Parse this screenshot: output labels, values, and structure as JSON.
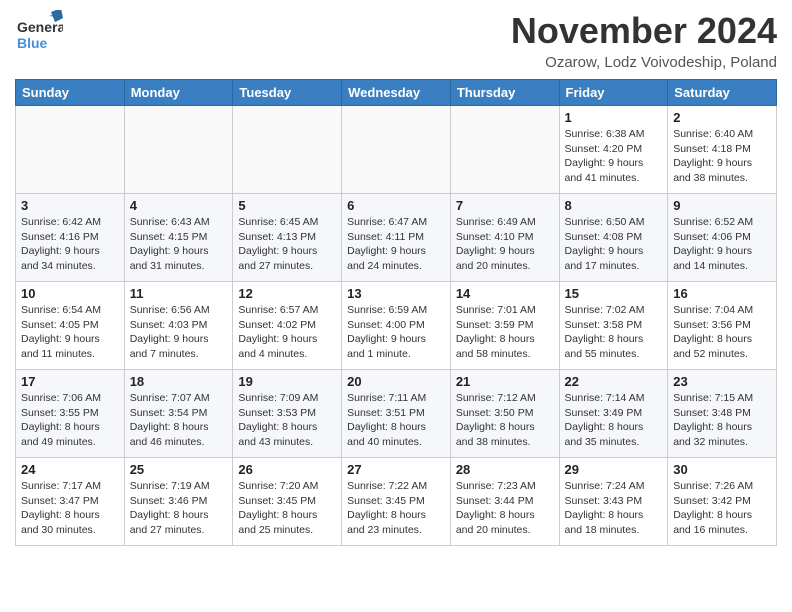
{
  "header": {
    "logo_line1": "General",
    "logo_line2": "Blue",
    "month_title": "November 2024",
    "location": "Ozarow, Lodz Voivodeship, Poland"
  },
  "weekdays": [
    "Sunday",
    "Monday",
    "Tuesday",
    "Wednesday",
    "Thursday",
    "Friday",
    "Saturday"
  ],
  "weeks": [
    [
      {
        "day": "",
        "info": ""
      },
      {
        "day": "",
        "info": ""
      },
      {
        "day": "",
        "info": ""
      },
      {
        "day": "",
        "info": ""
      },
      {
        "day": "",
        "info": ""
      },
      {
        "day": "1",
        "info": "Sunrise: 6:38 AM\nSunset: 4:20 PM\nDaylight: 9 hours\nand 41 minutes."
      },
      {
        "day": "2",
        "info": "Sunrise: 6:40 AM\nSunset: 4:18 PM\nDaylight: 9 hours\nand 38 minutes."
      }
    ],
    [
      {
        "day": "3",
        "info": "Sunrise: 6:42 AM\nSunset: 4:16 PM\nDaylight: 9 hours\nand 34 minutes."
      },
      {
        "day": "4",
        "info": "Sunrise: 6:43 AM\nSunset: 4:15 PM\nDaylight: 9 hours\nand 31 minutes."
      },
      {
        "day": "5",
        "info": "Sunrise: 6:45 AM\nSunset: 4:13 PM\nDaylight: 9 hours\nand 27 minutes."
      },
      {
        "day": "6",
        "info": "Sunrise: 6:47 AM\nSunset: 4:11 PM\nDaylight: 9 hours\nand 24 minutes."
      },
      {
        "day": "7",
        "info": "Sunrise: 6:49 AM\nSunset: 4:10 PM\nDaylight: 9 hours\nand 20 minutes."
      },
      {
        "day": "8",
        "info": "Sunrise: 6:50 AM\nSunset: 4:08 PM\nDaylight: 9 hours\nand 17 minutes."
      },
      {
        "day": "9",
        "info": "Sunrise: 6:52 AM\nSunset: 4:06 PM\nDaylight: 9 hours\nand 14 minutes."
      }
    ],
    [
      {
        "day": "10",
        "info": "Sunrise: 6:54 AM\nSunset: 4:05 PM\nDaylight: 9 hours\nand 11 minutes."
      },
      {
        "day": "11",
        "info": "Sunrise: 6:56 AM\nSunset: 4:03 PM\nDaylight: 9 hours\nand 7 minutes."
      },
      {
        "day": "12",
        "info": "Sunrise: 6:57 AM\nSunset: 4:02 PM\nDaylight: 9 hours\nand 4 minutes."
      },
      {
        "day": "13",
        "info": "Sunrise: 6:59 AM\nSunset: 4:00 PM\nDaylight: 9 hours\nand 1 minute."
      },
      {
        "day": "14",
        "info": "Sunrise: 7:01 AM\nSunset: 3:59 PM\nDaylight: 8 hours\nand 58 minutes."
      },
      {
        "day": "15",
        "info": "Sunrise: 7:02 AM\nSunset: 3:58 PM\nDaylight: 8 hours\nand 55 minutes."
      },
      {
        "day": "16",
        "info": "Sunrise: 7:04 AM\nSunset: 3:56 PM\nDaylight: 8 hours\nand 52 minutes."
      }
    ],
    [
      {
        "day": "17",
        "info": "Sunrise: 7:06 AM\nSunset: 3:55 PM\nDaylight: 8 hours\nand 49 minutes."
      },
      {
        "day": "18",
        "info": "Sunrise: 7:07 AM\nSunset: 3:54 PM\nDaylight: 8 hours\nand 46 minutes."
      },
      {
        "day": "19",
        "info": "Sunrise: 7:09 AM\nSunset: 3:53 PM\nDaylight: 8 hours\nand 43 minutes."
      },
      {
        "day": "20",
        "info": "Sunrise: 7:11 AM\nSunset: 3:51 PM\nDaylight: 8 hours\nand 40 minutes."
      },
      {
        "day": "21",
        "info": "Sunrise: 7:12 AM\nSunset: 3:50 PM\nDaylight: 8 hours\nand 38 minutes."
      },
      {
        "day": "22",
        "info": "Sunrise: 7:14 AM\nSunset: 3:49 PM\nDaylight: 8 hours\nand 35 minutes."
      },
      {
        "day": "23",
        "info": "Sunrise: 7:15 AM\nSunset: 3:48 PM\nDaylight: 8 hours\nand 32 minutes."
      }
    ],
    [
      {
        "day": "24",
        "info": "Sunrise: 7:17 AM\nSunset: 3:47 PM\nDaylight: 8 hours\nand 30 minutes."
      },
      {
        "day": "25",
        "info": "Sunrise: 7:19 AM\nSunset: 3:46 PM\nDaylight: 8 hours\nand 27 minutes."
      },
      {
        "day": "26",
        "info": "Sunrise: 7:20 AM\nSunset: 3:45 PM\nDaylight: 8 hours\nand 25 minutes."
      },
      {
        "day": "27",
        "info": "Sunrise: 7:22 AM\nSunset: 3:45 PM\nDaylight: 8 hours\nand 23 minutes."
      },
      {
        "day": "28",
        "info": "Sunrise: 7:23 AM\nSunset: 3:44 PM\nDaylight: 8 hours\nand 20 minutes."
      },
      {
        "day": "29",
        "info": "Sunrise: 7:24 AM\nSunset: 3:43 PM\nDaylight: 8 hours\nand 18 minutes."
      },
      {
        "day": "30",
        "info": "Sunrise: 7:26 AM\nSunset: 3:42 PM\nDaylight: 8 hours\nand 16 minutes."
      }
    ]
  ]
}
